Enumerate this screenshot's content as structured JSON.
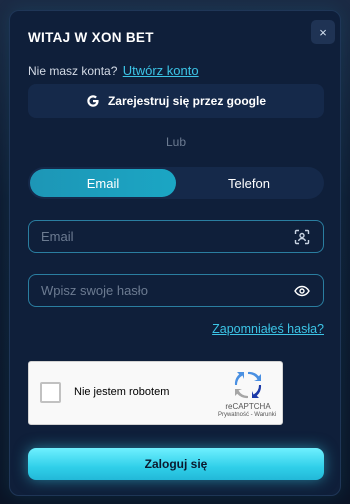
{
  "modal": {
    "title": "WITAJ W XON BET",
    "close_icon": "×",
    "no_account_text": "Nie masz konta?",
    "create_account_link": "Utwórz konto",
    "google_button_label": "Zarejestruj się przez google",
    "divider_text": "Lub",
    "tabs": [
      {
        "label": "Email",
        "active": true
      },
      {
        "label": "Telefon",
        "active": false
      }
    ],
    "email_field": {
      "value": "",
      "placeholder": "Email"
    },
    "password_field": {
      "value": "",
      "placeholder": "Wpisz swoje hasło"
    },
    "forgot_password_link": "Zapomniałeś hasła?",
    "recaptcha": {
      "label": "Nie jestem robotem",
      "brand": "reCAPTCHA",
      "links": "Prywatność - Warunki",
      "checked": false
    },
    "login_button_label": "Zaloguj się"
  },
  "colors": {
    "accent": "#3cc4e6",
    "panel": "#0f1f3a",
    "button_gradient_top": "#6ff0ff",
    "button_gradient_bottom": "#22b8d8"
  },
  "icons": {
    "close": "close-icon",
    "google": "google-icon",
    "email_field": "scan-icon",
    "password_field": "eye-icon",
    "recaptcha": "recaptcha-logo-icon"
  }
}
